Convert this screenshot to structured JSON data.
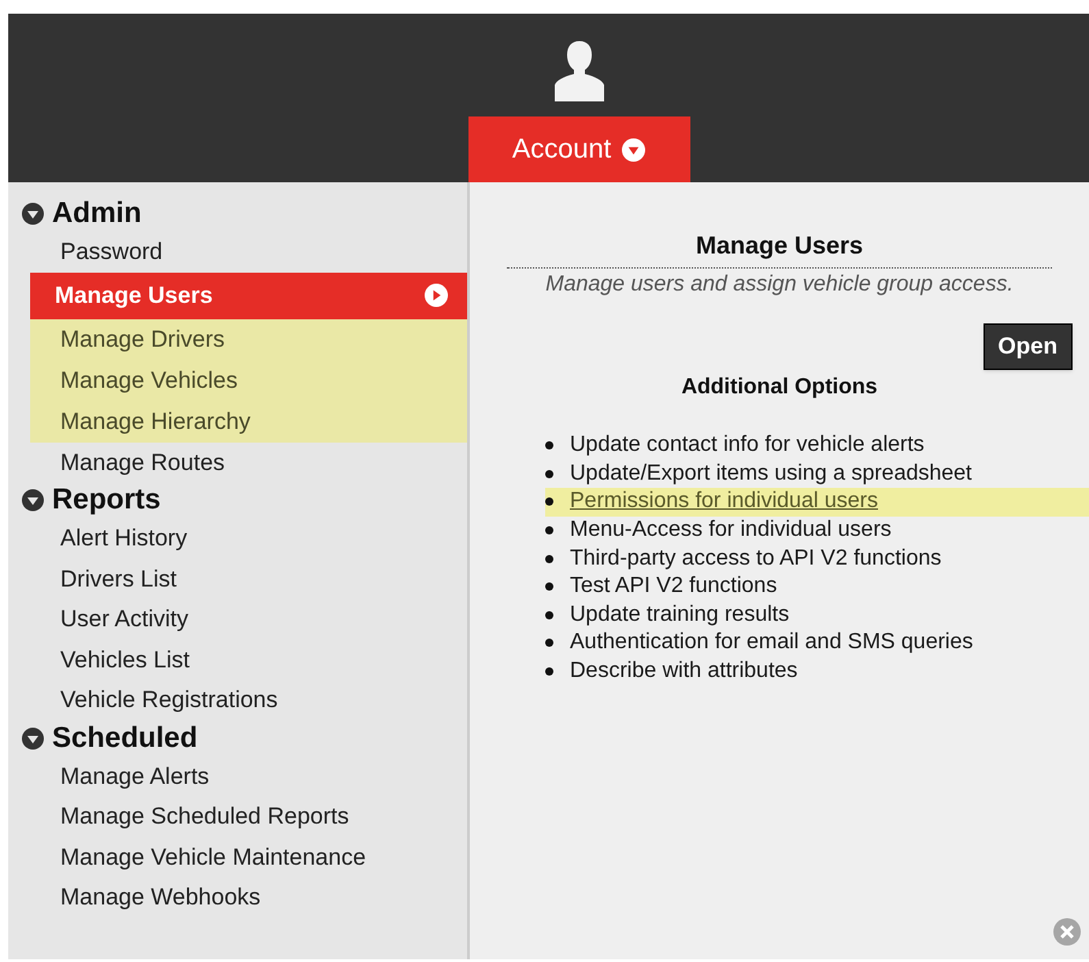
{
  "account_button": {
    "label": "Account"
  },
  "menu": {
    "sections": [
      {
        "title": "Admin",
        "expanded": true,
        "items": [
          {
            "label": "Password",
            "selected": false,
            "highlighted": false
          },
          {
            "label": "Manage Users",
            "selected": true,
            "highlighted": false
          },
          {
            "label": "Manage Drivers",
            "selected": false,
            "highlighted": true
          },
          {
            "label": "Manage Vehicles",
            "selected": false,
            "highlighted": true
          },
          {
            "label": "Manage Hierarchy",
            "selected": false,
            "highlighted": true
          },
          {
            "label": "Manage Routes",
            "selected": false,
            "highlighted": false
          }
        ]
      },
      {
        "title": "Reports",
        "expanded": true,
        "items": [
          {
            "label": "Alert History",
            "selected": false,
            "highlighted": false
          },
          {
            "label": "Drivers List",
            "selected": false,
            "highlighted": false
          },
          {
            "label": "User Activity",
            "selected": false,
            "highlighted": false
          },
          {
            "label": "Vehicles List",
            "selected": false,
            "highlighted": false
          },
          {
            "label": "Vehicle Registrations",
            "selected": false,
            "highlighted": false
          }
        ]
      },
      {
        "title": "Scheduled",
        "expanded": true,
        "items": [
          {
            "label": "Manage Alerts",
            "selected": false,
            "highlighted": false
          },
          {
            "label": "Manage Scheduled Reports",
            "selected": false,
            "highlighted": false
          },
          {
            "label": "Manage Vehicle Maintenance",
            "selected": false,
            "highlighted": false
          },
          {
            "label": "Manage Webhooks",
            "selected": false,
            "highlighted": false
          }
        ]
      }
    ]
  },
  "detail": {
    "title": "Manage Users",
    "subtitle": "Manage users and assign vehicle group access.",
    "open_button": "Open",
    "options_heading": "Additional Options",
    "options": [
      {
        "text": "Update contact info for vehicle alerts",
        "kind": "text",
        "highlighted": false
      },
      {
        "text": "Update/Export items using a spreadsheet",
        "kind": "text",
        "highlighted": false
      },
      {
        "text": "Permissions for individual users",
        "kind": "link",
        "highlighted": true
      },
      {
        "text": "Menu-Access for individual users",
        "kind": "text",
        "highlighted": false
      },
      {
        "text": "Third-party access to API V2 functions",
        "kind": "text",
        "highlighted": false
      },
      {
        "text": "Test API V2 functions",
        "kind": "text",
        "highlighted": false
      },
      {
        "text": "Update training results",
        "kind": "text",
        "highlighted": false
      },
      {
        "text": "Authentication for email and SMS queries",
        "kind": "text",
        "highlighted": false
      },
      {
        "text": "Describe with attributes",
        "kind": "text",
        "highlighted": false
      }
    ]
  }
}
